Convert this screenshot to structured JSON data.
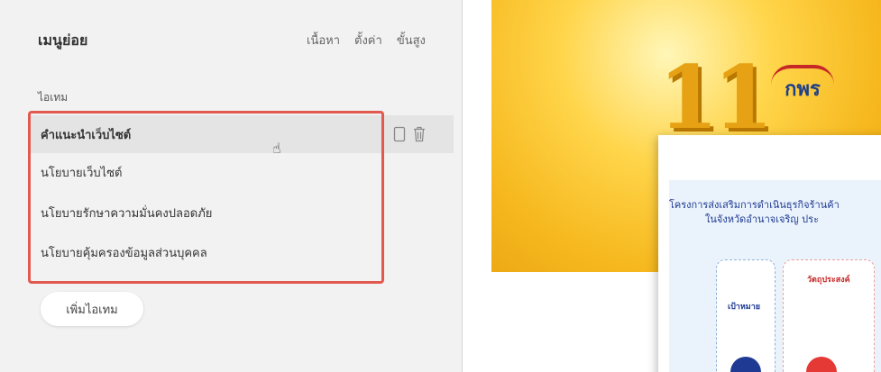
{
  "panel": {
    "title": "เมนูย่อย",
    "tabs": [
      "เนื้อหา",
      "ตั้งค่า",
      "ขั้นสูง"
    ],
    "section_label": "ไอเทม",
    "items": [
      "คำแนะนำเว็บไซต์",
      "นโยบายเว็บไซต์",
      "นโยบายรักษาความมั่นคงปลอดภัย",
      "นโยบายคุ้มครองข้อมูลส่วนบุคคล"
    ],
    "add_button": "เพิ่มไอเทม"
  },
  "preview": {
    "big_number": "11",
    "logo_text": "กพร",
    "infographic_title_1": "โครงการส่งเสริมการดำเนินธุรกิจร้านค้า",
    "infographic_title_2": "ในจังหวัดอำนาจเจริญ ประ",
    "goal_label": "เป้าหมาย",
    "objective_label": "วัตถุประสงค์"
  },
  "colors": {
    "highlight": "#e25a4f",
    "panel_bg": "#f2f2f2",
    "selected_bg": "#e4e4e4"
  }
}
